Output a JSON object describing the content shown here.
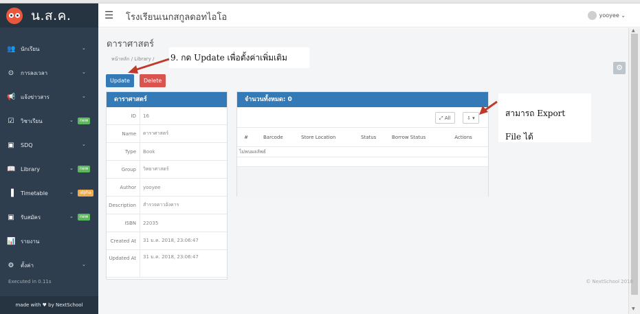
{
  "brand": {
    "title": "น.ส.ค."
  },
  "sidebar": {
    "items": [
      {
        "label": "นักเรียน",
        "icon": "users-icon",
        "glyph": "👥",
        "chev": true
      },
      {
        "label": "การลงเวลา",
        "icon": "clock-icon",
        "glyph": "⊙",
        "chev": true
      },
      {
        "label": "แจ้งข่าวสาร",
        "icon": "megaphone-icon",
        "glyph": "📢",
        "chev": true
      },
      {
        "label": "วิชาเรียน",
        "icon": "calendar-check-icon",
        "glyph": "☑",
        "chev": true,
        "badge": "new",
        "badge_color": "#5cb85c"
      },
      {
        "label": "SDQ",
        "icon": "clipboard-icon",
        "glyph": "▣",
        "chev": true
      },
      {
        "label": "Library",
        "icon": "book-icon",
        "glyph": "📖",
        "chev": true,
        "badge": "new",
        "badge_color": "#5cb85c"
      },
      {
        "label": "Timetable",
        "icon": "database-icon",
        "glyph": "▐",
        "chev": true,
        "badge": "alpha",
        "badge_color": "#f0ad4e"
      },
      {
        "label": "รับสมัคร",
        "icon": "form-icon",
        "glyph": "▣",
        "chev": true,
        "badge": "new",
        "badge_color": "#5cb85c"
      },
      {
        "label": "รายงาน",
        "icon": "bar-chart-icon",
        "glyph": "📊",
        "chev": false
      },
      {
        "label": "ตั้งค่า",
        "icon": "cogs-icon",
        "glyph": "⚙",
        "chev": true
      }
    ],
    "footer": "made with ♥ by NextSchool"
  },
  "header": {
    "school_name": "โรงเรียนเนกสกูลดอทไอโอ",
    "user": "yooyee"
  },
  "page": {
    "title": "ดาราศาสตร์",
    "breadcrumb": "หน้าหลัก / Library /",
    "update_label": "Update",
    "delete_label": "Delete"
  },
  "detail": {
    "heading": "ดาราศาสตร์",
    "rows": [
      {
        "key": "ID",
        "value": "16"
      },
      {
        "key": "Name",
        "value": "ดาราศาสตร์"
      },
      {
        "key": "Type",
        "value": "Book"
      },
      {
        "key": "Group",
        "value": "วิทยาศาสตร์"
      },
      {
        "key": "Author",
        "value": "yooyee"
      },
      {
        "key": "Description",
        "value": "สำรวจดาวอังคาร"
      },
      {
        "key": "ISBN",
        "value": "22035"
      },
      {
        "key": "Created At",
        "value": "31 ม.ค. 2018, 23:06:47"
      },
      {
        "key": "Updated At",
        "value": "31 ม.ค. 2018, 23:06:47"
      }
    ]
  },
  "list": {
    "heading": "จำนวนทั้งหมด: 0",
    "all_label": "All",
    "columns": [
      "#",
      "Barcode",
      "Store Location",
      "Status",
      "Borrow Status",
      "Actions"
    ],
    "no_results": "ไม่พบผลลัพธ์"
  },
  "annotations": {
    "update_note": "9. กด Update เพื่อตั้งค่าเพิ่มเติม",
    "export_note_1": "สามารถ Export",
    "export_note_2": "File ได้"
  },
  "footer": {
    "left": "Executed in 0.11s",
    "right": "© NextSchool 2018"
  },
  "colors": {
    "sidebar_bg": "#2f3e4e",
    "primary": "#337ab7",
    "danger": "#d9534f",
    "arrow": "#c0392b"
  }
}
